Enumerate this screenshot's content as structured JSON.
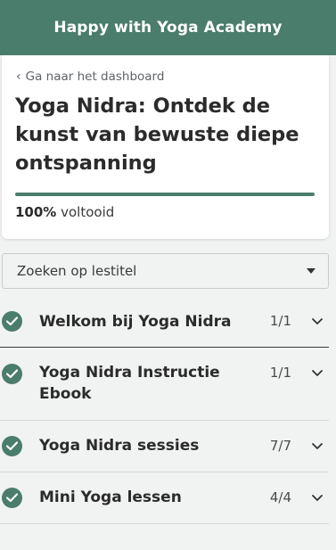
{
  "header": {
    "title": "Happy with Yoga Academy"
  },
  "course": {
    "back_label": "Ga naar het dashboard",
    "title": "Yoga Nidra: Ontdek de kunst van bewuste diepe ontspanning",
    "progress_percent": "100%",
    "progress_value": 1.0,
    "progress_suffix": "voltooid"
  },
  "search": {
    "label": "Zoeken op lestitel"
  },
  "sections": [
    {
      "title": "Welkom bij Yoga Nidra",
      "count": "1/1",
      "completed": true
    },
    {
      "title": "Yoga Nidra Instructie Ebook",
      "count": "1/1",
      "completed": true
    },
    {
      "title": "Yoga Nidra sessies",
      "count": "7/7",
      "completed": true
    },
    {
      "title": "Mini Yoga lessen",
      "count": "4/4",
      "completed": true
    }
  ],
  "colors": {
    "accent": "#4a7d6b",
    "background": "#f1f2f2"
  }
}
